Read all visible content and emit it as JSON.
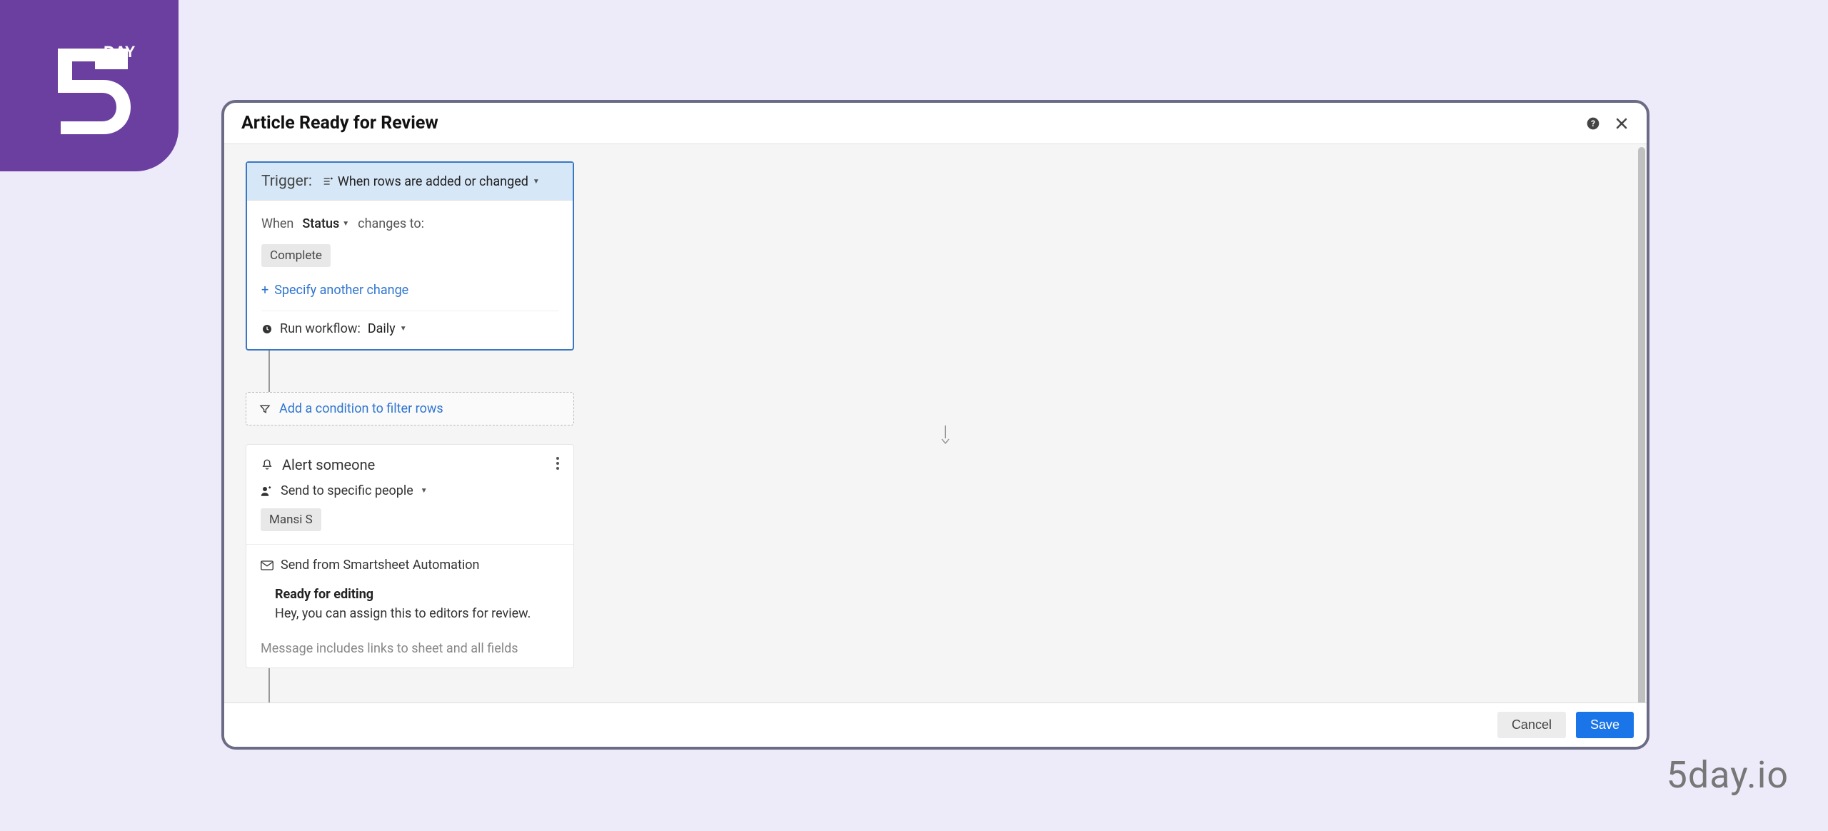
{
  "logo_day_text": "DAY",
  "footer_url": "5day.io",
  "modal": {
    "title": "Article Ready for Review",
    "trigger": {
      "label": "Trigger:",
      "description": "When rows are added or changed",
      "when_label": "When",
      "field": "Status",
      "changes_to_label": "changes to:",
      "value": "Complete",
      "specify_link": "Specify another change",
      "run_label": "Run workflow:",
      "frequency": "Daily"
    },
    "filter": {
      "link": "Add a condition to filter rows"
    },
    "action": {
      "title": "Alert someone",
      "send_to_label": "Send to specific people",
      "recipient": "Mansi S",
      "send_from_label": "Send from Smartsheet Automation",
      "message_title": "Ready for editing",
      "message_body": "Hey, you can assign this to editors for review.",
      "message_note": "Message includes links to sheet and all fields"
    },
    "buttons": {
      "cancel": "Cancel",
      "save": "Save"
    }
  }
}
